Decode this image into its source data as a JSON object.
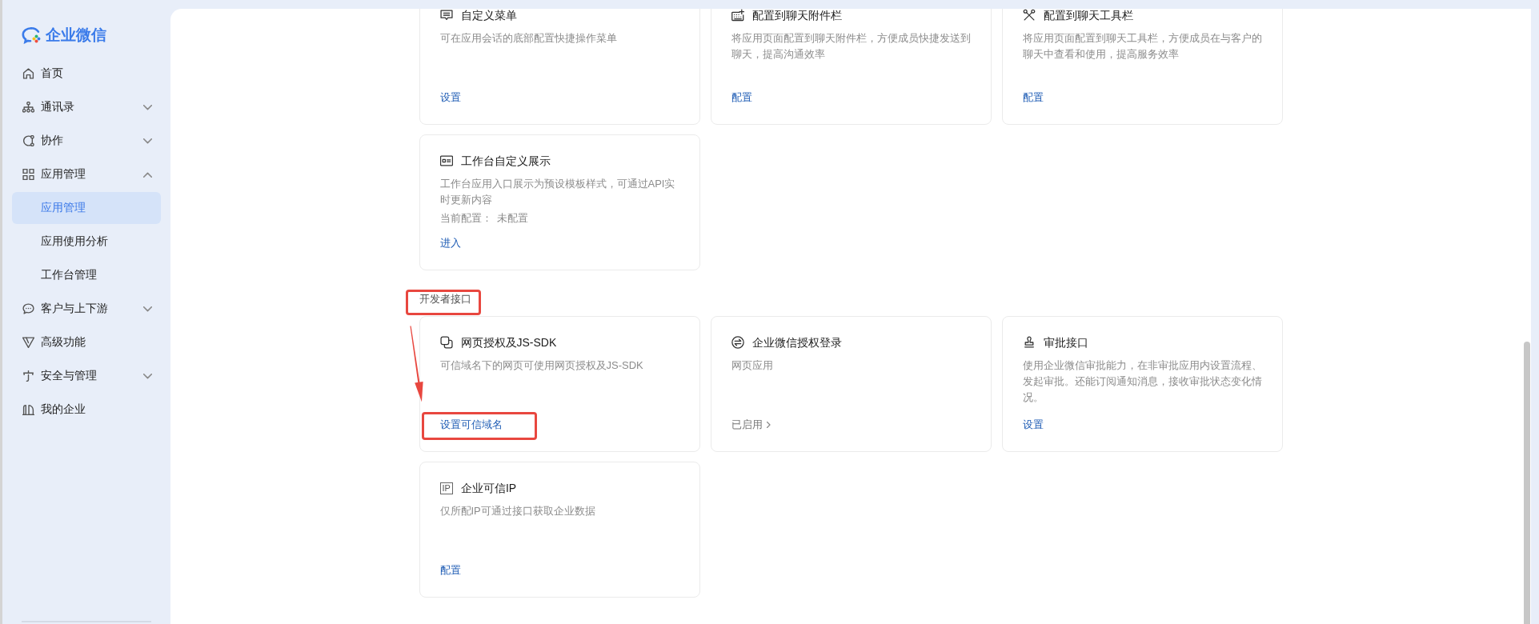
{
  "sidebar": {
    "logo": {
      "text": "企业微信"
    },
    "nav": [
      {
        "label": "首页",
        "kind": "page",
        "selected": false
      },
      {
        "label": "通讯录",
        "kind": "group",
        "expanded": false,
        "selected": false
      },
      {
        "label": "协作",
        "kind": "group",
        "expanded": false,
        "selected": false
      },
      {
        "label": "应用管理",
        "kind": "group",
        "expanded": true,
        "selected": false,
        "children": [
          {
            "label": "应用管理",
            "selected": true
          },
          {
            "label": "应用使用分析",
            "selected": false
          },
          {
            "label": "工作台管理",
            "selected": false
          }
        ]
      },
      {
        "label": "客户与上下游",
        "kind": "group",
        "expanded": false,
        "selected": false
      },
      {
        "label": "高级功能",
        "kind": "page",
        "selected": false
      },
      {
        "label": "安全与管理",
        "kind": "group",
        "expanded": false,
        "selected": false
      },
      {
        "label": "我的企业",
        "kind": "page",
        "selected": false
      }
    ]
  },
  "app_cards": [
    {
      "title": "自定义菜单",
      "description": "可在应用会话的底部配置快捷操作菜单",
      "action": {
        "kind": "link",
        "text": "设置",
        "highlighted": false
      }
    },
    {
      "title": "配置到聊天附件栏",
      "description": "将应用页面配置到聊天附件栏，方便成员快捷发送到聊天，提高沟通效率",
      "action": {
        "kind": "link",
        "text": "配置",
        "highlighted": false
      }
    },
    {
      "title": "配置到聊天工具栏",
      "description": "将应用页面配置到聊天工具栏，方便成员在与客户的聊天中查看和使用，提高服务效率",
      "action": {
        "kind": "link",
        "text": "配置",
        "highlighted": false
      }
    },
    {
      "title": "工作台自定义展示",
      "description": "工作台应用入口展示为预设模板样式，可通过API实时更新内容",
      "config": {
        "label": "当前配置：",
        "value": "未配置"
      },
      "action": {
        "kind": "link",
        "text": "进入",
        "highlighted": false
      }
    }
  ],
  "developer_section": {
    "title": "开发者接口",
    "highlighted": true,
    "cards": [
      {
        "title": "网页授权及JS-SDK",
        "description": "可信域名下的网页可使用网页授权及JS-SDK",
        "action": {
          "kind": "link",
          "text": "设置可信域名",
          "highlighted": true
        }
      },
      {
        "title": "企业微信授权登录",
        "description": "网页应用",
        "action": {
          "kind": "status",
          "text": "已启用"
        }
      },
      {
        "title": "审批接口",
        "description": "使用企业微信审批能力，在非审批应用内设置流程、发起审批。还能订阅通知消息，接收审批状态变化情况。",
        "action": {
          "kind": "link",
          "text": "设置",
          "highlighted": false
        }
      },
      {
        "icon_text": "IP",
        "title": "企业可信IP",
        "description": "仅所配IP可通过接口获取企业数据",
        "action": {
          "kind": "link",
          "text": "配置",
          "highlighted": false
        }
      }
    ]
  },
  "annotation_arrow": true
}
